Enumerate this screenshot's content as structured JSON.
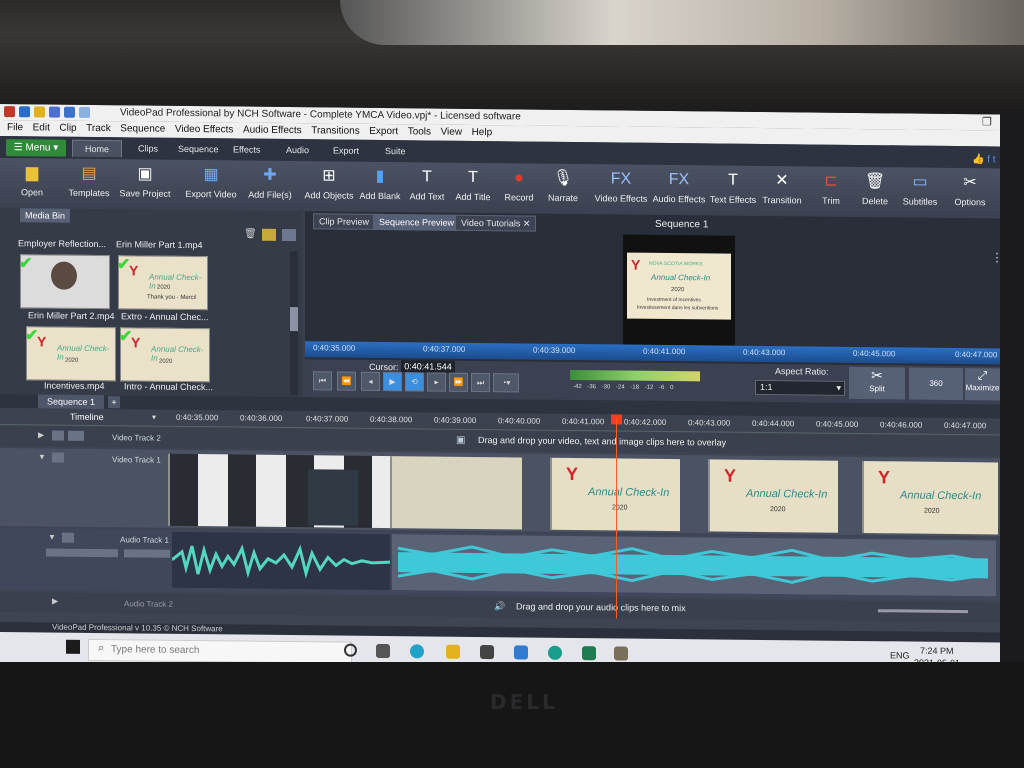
{
  "window": {
    "title": "VideoPad Professional by NCH Software - Complete YMCA Video.vpj* - Licensed software"
  },
  "menubar": [
    "File",
    "Edit",
    "Clip",
    "Track",
    "Sequence",
    "Video Effects",
    "Audio Effects",
    "Transitions",
    "Export",
    "Tools",
    "View",
    "Help"
  ],
  "tabs": {
    "menu": "Menu",
    "items": [
      "Home",
      "Clips",
      "Sequence",
      "Effects",
      "Audio",
      "Export",
      "Suite"
    ]
  },
  "ribbon": {
    "open": "Open",
    "templates": "Templates",
    "save_project": "Save Project",
    "export_video": "Export Video",
    "add_files": "Add File(s)",
    "add_objects": "Add Objects",
    "add_blank": "Add Blank",
    "add_text": "Add Text",
    "add_title": "Add Title",
    "record": "Record",
    "narrate": "Narrate",
    "video_effects": "Video Effects",
    "audio_effects": "Audio Effects",
    "text_effects": "Text Effects",
    "transition": "Transition",
    "trim": "Trim",
    "delete": "Delete",
    "subtitles": "Subtitles",
    "options": "Options"
  },
  "media_bin": {
    "tab": "Media Bin",
    "top_captions": [
      "Employer Reflection...",
      "Erin Miller Part 1.mp4"
    ],
    "items": [
      {
        "caption": "Erin Miller Part 2.mp4"
      },
      {
        "caption": "Extro - Annual Chec..."
      },
      {
        "caption": "Incentives.mp4"
      },
      {
        "caption": "Intro - Annual Check..."
      }
    ],
    "thumb_text": "Annual Check-In",
    "thumb_year": "2020",
    "thumb_sub": "Thank you - Merci!"
  },
  "preview": {
    "tabs": [
      "Clip Preview",
      "Sequence Preview",
      "Video Tutorials"
    ],
    "sequence_title": "Sequence 1",
    "card_heading": "NOVA SCOTIA WORKS",
    "card_title": "Annual Check-In",
    "card_year": "2020",
    "card_line1": "Investment of Incentives",
    "card_line2": "Investissement dans les subventions",
    "ruler": [
      "0:40:35.000",
      "0:40:37.000",
      "0:40:39.000",
      "0:40:41.000",
      "0:40:43.000",
      "0:40:45.000",
      "0:40:47.000"
    ],
    "cursor_label": "Cursor:",
    "cursor_value": "0:40:41.544",
    "meter": [
      "-42",
      "-36",
      "-30",
      "-24",
      "-18",
      "-12",
      "-6",
      "0"
    ],
    "aspect_label": "Aspect Ratio:",
    "aspect_value": "1:1",
    "split": "Split",
    "btn_360": "360",
    "maximize": "Maximize"
  },
  "timeline": {
    "sequence_tab": "Sequence 1",
    "timeline_label": "Timeline",
    "ruler": [
      "0:40:35.000",
      "0:40:36.000",
      "0:40:37.000",
      "0:40:38.000",
      "0:40:39.000",
      "0:40:40.000",
      "0:40:41.000",
      "0:40:42.000",
      "0:40:43.000",
      "0:40:44.000",
      "0:40:45.000",
      "0:40:46.000",
      "0:40:47.000"
    ],
    "video_track_2": "Video Track 2",
    "video_overlay_hint": "Drag and drop your video, text and image clips here to overlay",
    "video_track_1": "Video Track 1",
    "audio_track_1": "Audio Track 1",
    "audio_track_2": "Audio Track 2",
    "audio_hint": "Drag and drop your audio clips here to mix",
    "clip_name": "Annual Check-In",
    "clip_year": "2020"
  },
  "status": {
    "version": "VideoPad Professional v 10.35 © NCH Software"
  },
  "taskbar": {
    "search_placeholder": "Type here to search",
    "time": "7:24 PM",
    "date": "2021-05-01",
    "lang": "ENG"
  },
  "bezel": {
    "brand": "DELL"
  },
  "colors": {
    "accent_green": "#2f8a3a",
    "waveform": "#3fc8d8",
    "playhead": "#ff3b1f",
    "ruler_blue": "#2b6fc4"
  }
}
